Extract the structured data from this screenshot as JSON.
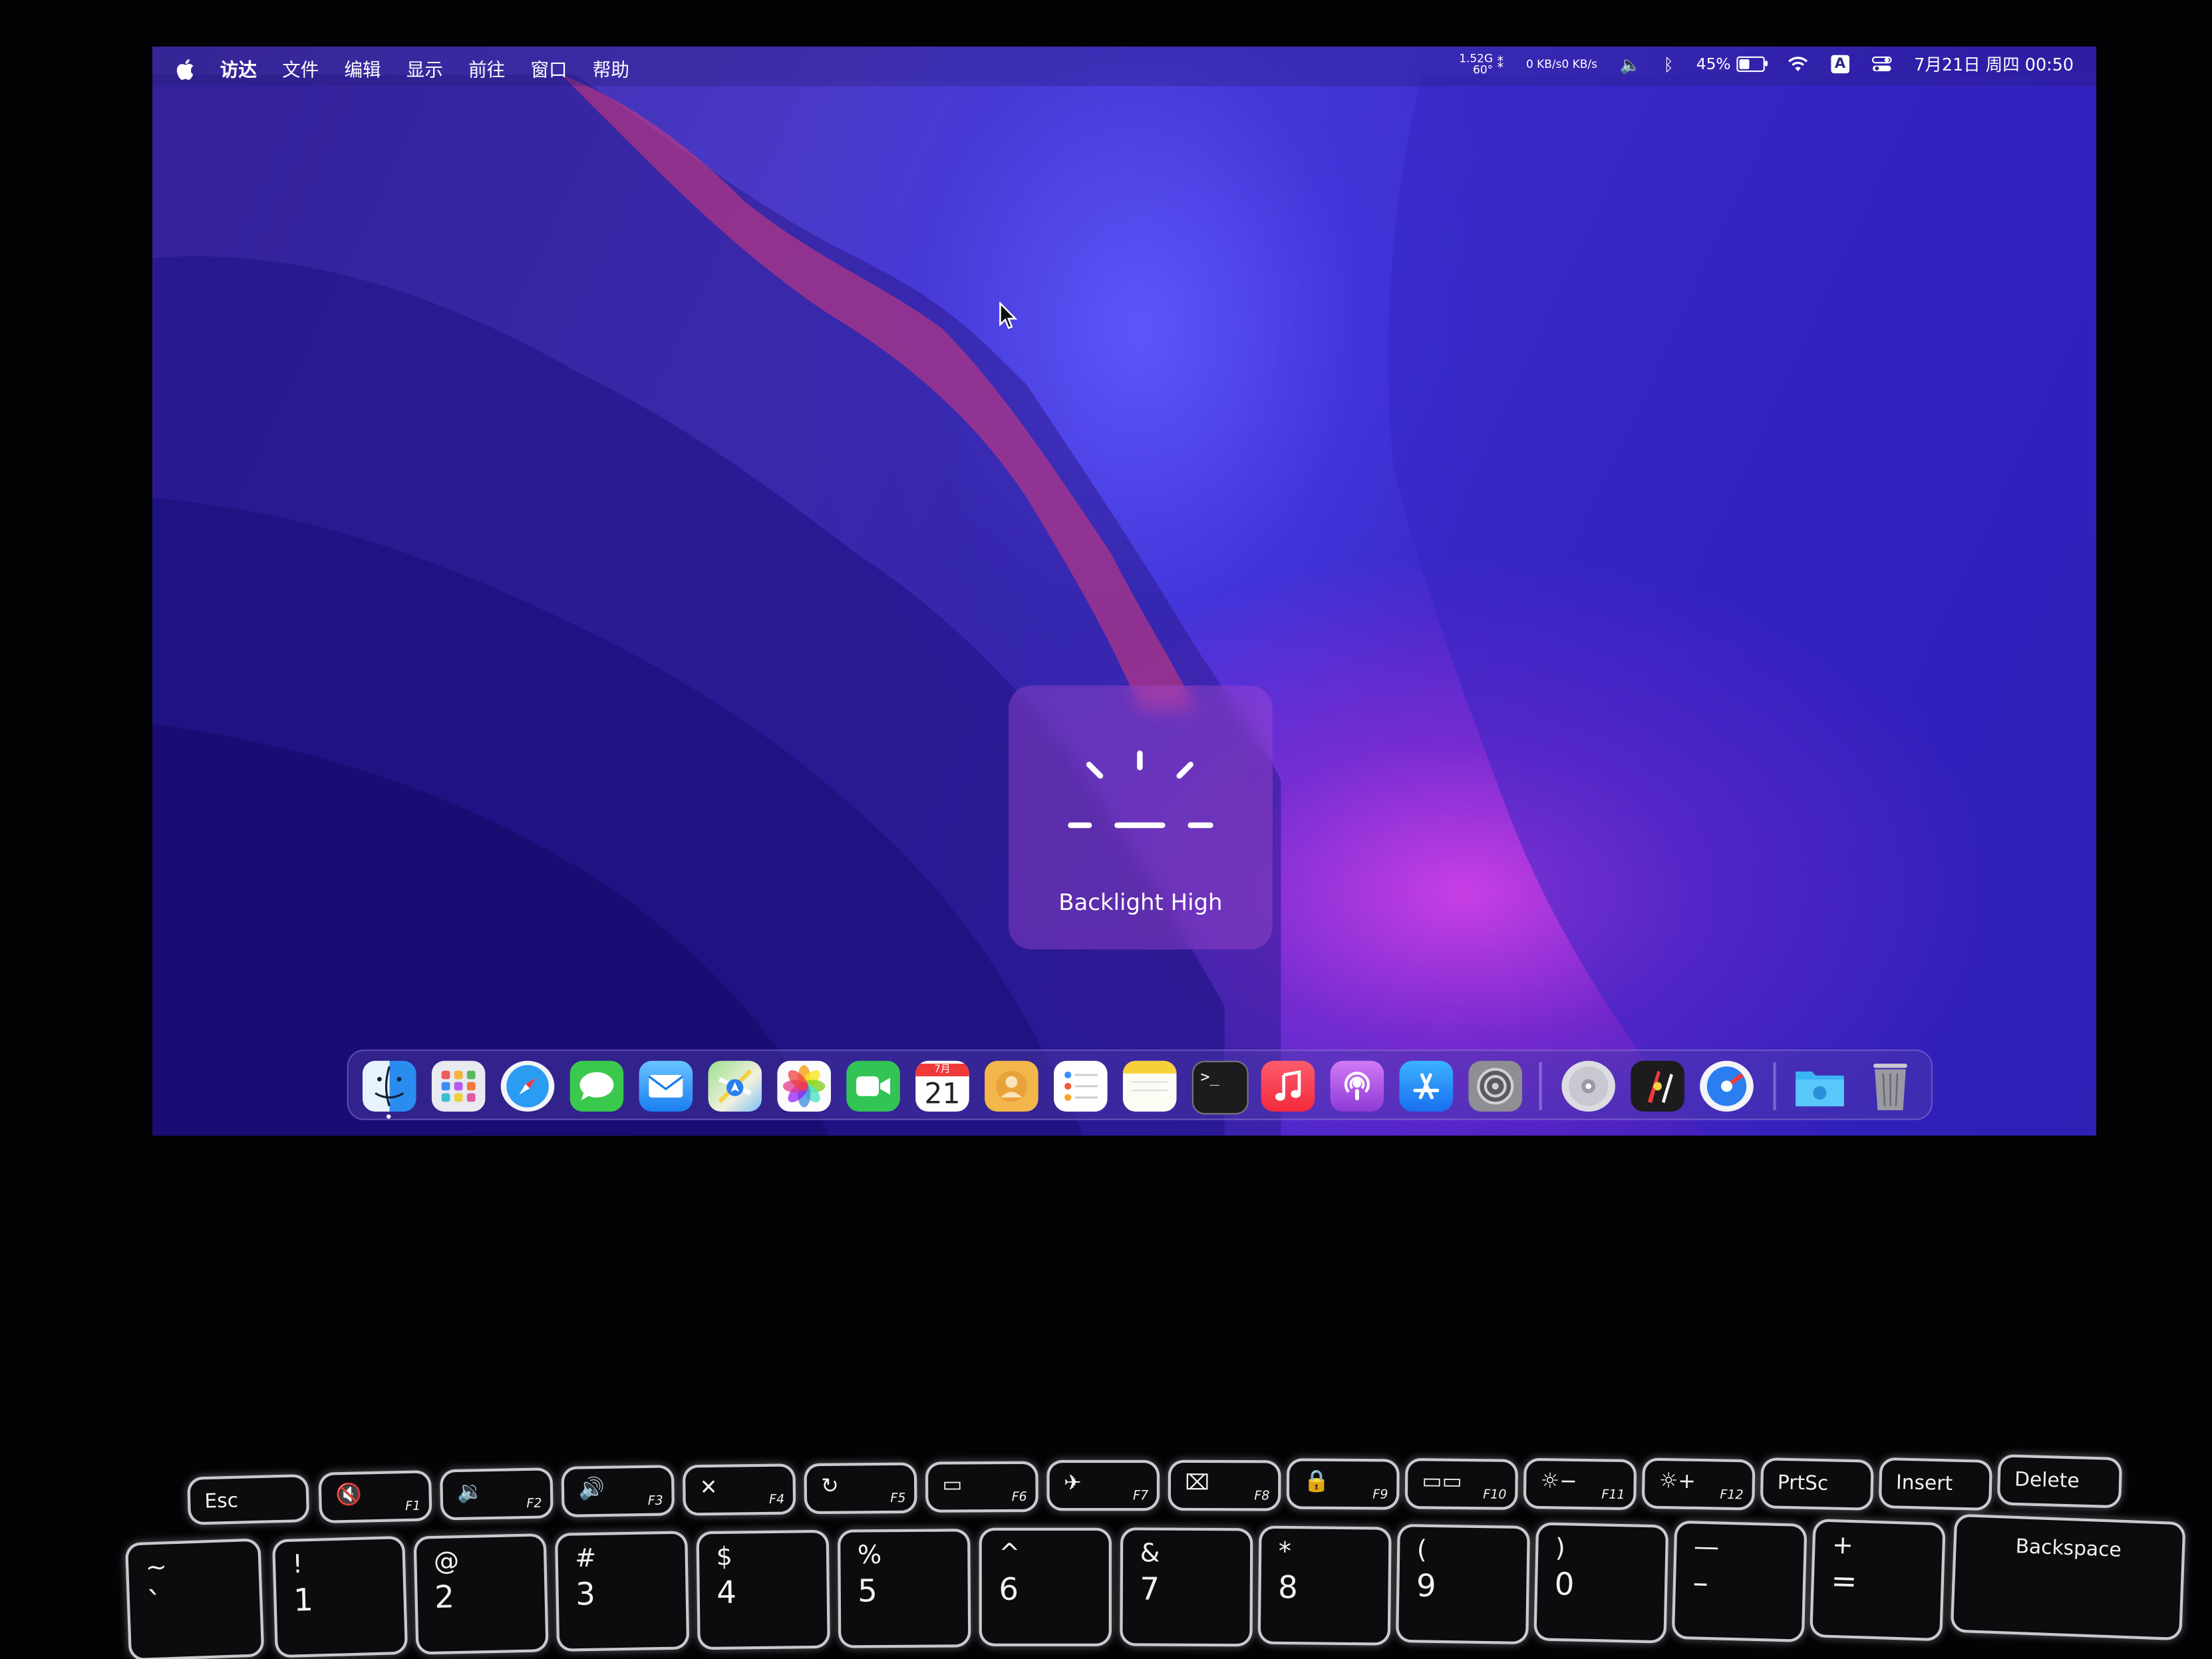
{
  "menubar": {
    "items": [
      "访达",
      "文件",
      "编辑",
      "显示",
      "前往",
      "窗口",
      "帮助"
    ],
    "stats_left": [
      "1.52G",
      "60°"
    ],
    "net_up": "0 KB/s",
    "net_down": "0 KB/s",
    "battery_percent": "45%",
    "battery_level": 0.45,
    "input_method": "A",
    "datetime": "7月21日 周四 00:50"
  },
  "hud": {
    "label": "Backlight High"
  },
  "dock": {
    "calendar_month": "7月",
    "calendar_day": "21",
    "apps": [
      "Finder",
      "Launchpad",
      "Safari",
      "Messages",
      "Mail",
      "Maps",
      "Photos",
      "FaceTime",
      "Calendar",
      "Contacts",
      "Reminders",
      "Notes",
      "Terminal",
      "Music",
      "Podcasts",
      "App Store",
      "System Preferences",
      "Disk Utility",
      "Sketch-like App",
      "Stats App",
      "Downloads Folder",
      "Trash"
    ]
  },
  "keyboard": {
    "fn_row": [
      {
        "label": "Esc",
        "fn": ""
      },
      {
        "label": "🔇",
        "fn": "F1"
      },
      {
        "label": "🔉",
        "fn": "F2"
      },
      {
        "label": "🔊",
        "fn": "F3"
      },
      {
        "label": "✕",
        "fn": "F4"
      },
      {
        "label": "↻",
        "fn": "F5"
      },
      {
        "label": "▭",
        "fn": "F6"
      },
      {
        "label": "✈",
        "fn": "F7"
      },
      {
        "label": "⌧",
        "fn": "F8"
      },
      {
        "label": "🔒",
        "fn": "F9"
      },
      {
        "label": "▭▭",
        "fn": "F10"
      },
      {
        "label": "☼−",
        "fn": "F11"
      },
      {
        "label": "☼+",
        "fn": "F12"
      },
      {
        "label": "PrtSc",
        "fn": ""
      },
      {
        "label": "Insert",
        "fn": ""
      },
      {
        "label": "Delete",
        "fn": ""
      }
    ],
    "num_row": [
      {
        "top": "~",
        "bot": "`"
      },
      {
        "top": "!",
        "bot": "1"
      },
      {
        "top": "@",
        "bot": "2"
      },
      {
        "top": "#",
        "bot": "3"
      },
      {
        "top": "$",
        "bot": "4"
      },
      {
        "top": "%",
        "bot": "5"
      },
      {
        "top": "^",
        "bot": "6"
      },
      {
        "top": "&",
        "bot": "7"
      },
      {
        "top": "*",
        "bot": "8"
      },
      {
        "top": "(",
        "bot": "9"
      },
      {
        "top": ")",
        "bot": "0"
      },
      {
        "top": "—",
        "bot": "–"
      },
      {
        "top": "+",
        "bot": "="
      }
    ],
    "backspace": "Backspace"
  },
  "colors": {
    "wallpaper_blue": "#3f2fd0",
    "wallpaper_magenta": "#e244eb",
    "hud_bg": "#aa50d2"
  }
}
